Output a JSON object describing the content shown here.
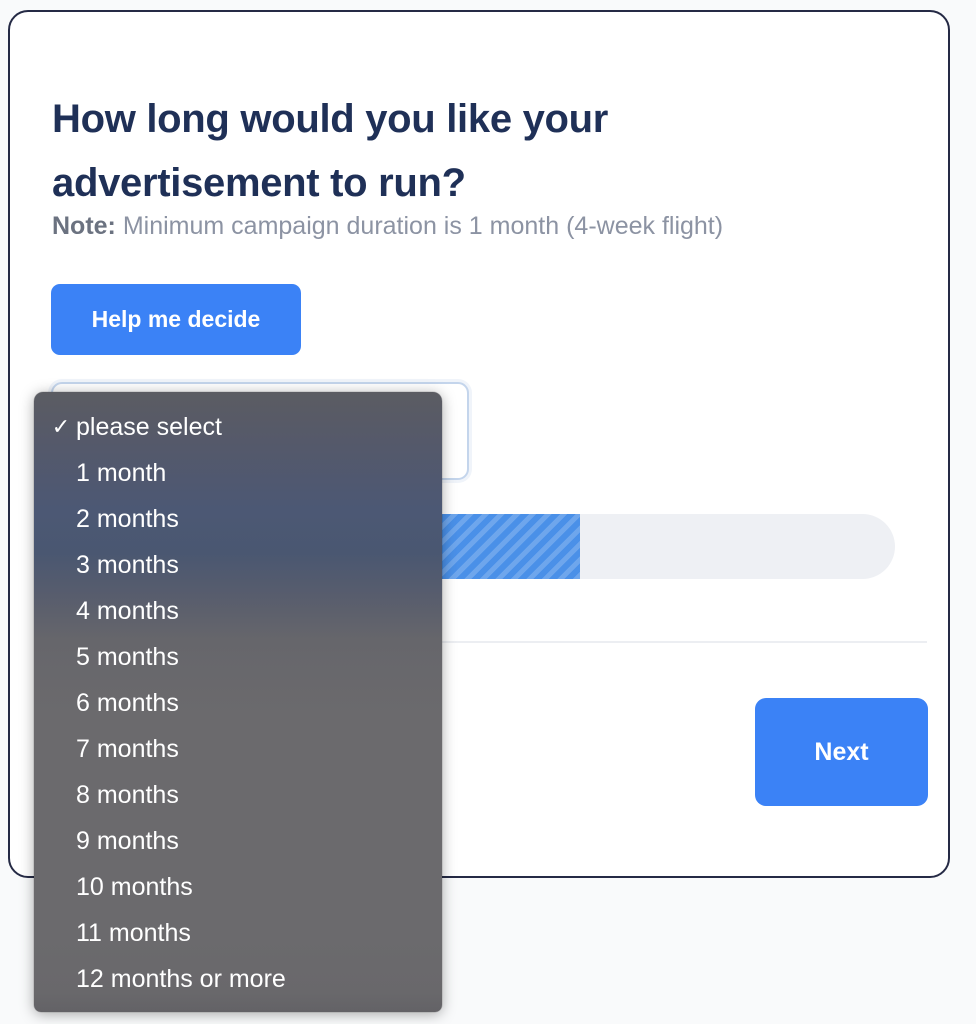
{
  "card": {
    "heading_line1": "How long would you like your",
    "heading_line2": "advertisement to run?",
    "note_label": "Note:",
    "note_text": " Minimum campaign duration is 1 month (4-week flight)",
    "help_button_label": "Help me decide",
    "next_button_label": "Next"
  },
  "select": {
    "value": "",
    "placeholder": "please select"
  },
  "progress": {
    "percent": 55,
    "fill_color": "#4a90e8",
    "track_color": "#eef0f4"
  },
  "dropdown": {
    "selected_index": 0,
    "check_glyph": "✓",
    "options": [
      {
        "label": "please select",
        "selected": true
      },
      {
        "label": "1 month",
        "selected": false
      },
      {
        "label": "2 months",
        "selected": false
      },
      {
        "label": "3 months",
        "selected": false
      },
      {
        "label": "4 months",
        "selected": false
      },
      {
        "label": "5 months",
        "selected": false
      },
      {
        "label": "6 months",
        "selected": false
      },
      {
        "label": "7 months",
        "selected": false
      },
      {
        "label": "8 months",
        "selected": false
      },
      {
        "label": "9 months",
        "selected": false
      },
      {
        "label": "10 months",
        "selected": false
      },
      {
        "label": "11 months",
        "selected": false
      },
      {
        "label": "12 months or more",
        "selected": false
      }
    ]
  },
  "colors": {
    "accent": "#3b82f6",
    "heading": "#1f3057",
    "note": "#8c93a3",
    "card_border": "#252a45",
    "page_background": "#f9fafb"
  }
}
